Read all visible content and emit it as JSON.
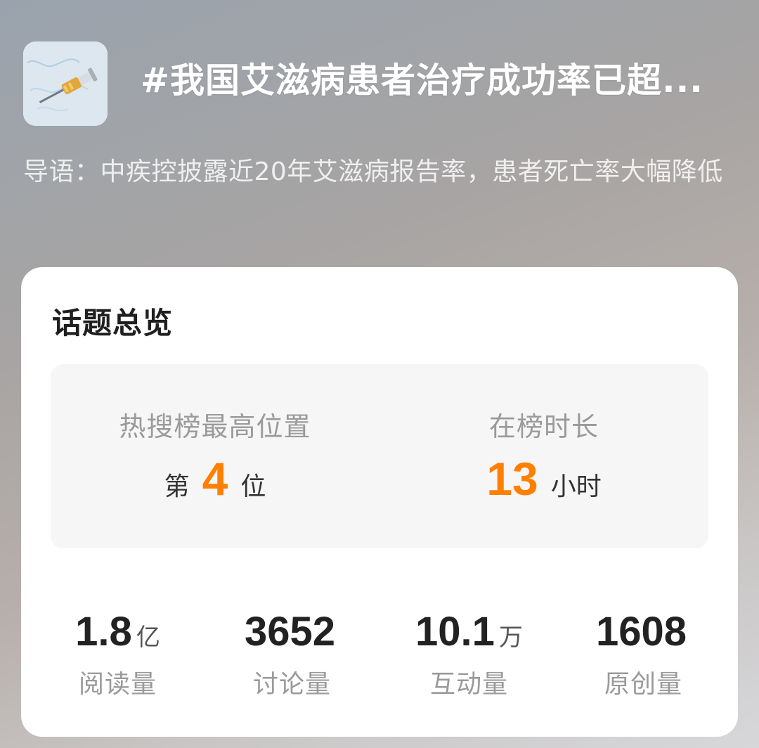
{
  "header": {
    "thumbnail_icon": "syringe-image",
    "title": "#我国艾滋病患者治疗成功率已超...",
    "intro": "导语：中疾控披露近20年艾滋病报告率，患者死亡率大幅降低"
  },
  "overview": {
    "title": "话题总览",
    "rank": {
      "peak_label": "热搜榜最高位置",
      "peak_prefix": "第",
      "peak_value": "4",
      "peak_suffix": "位",
      "duration_label": "在榜时长",
      "duration_value": "13",
      "duration_unit": "小时"
    },
    "stats": [
      {
        "value": "1.8",
        "unit": "亿",
        "label": "阅读量"
      },
      {
        "value": "3652",
        "unit": "",
        "label": "讨论量"
      },
      {
        "value": "10.1",
        "unit": "万",
        "label": "互动量"
      },
      {
        "value": "1608",
        "unit": "",
        "label": "原创量"
      }
    ]
  },
  "colors": {
    "accent": "#ff7f00",
    "card_bg": "#ffffff",
    "panel_bg": "#f6f6f6"
  }
}
